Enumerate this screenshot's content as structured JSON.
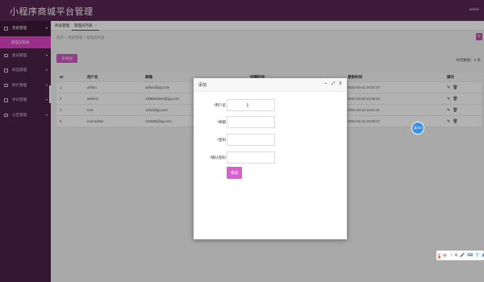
{
  "header": {
    "app_title": "小程序商城平台管理",
    "user": "admin"
  },
  "sidebar": {
    "items": [
      {
        "label": "系统管理",
        "arrow": "▾",
        "sub": [
          {
            "label": "管理员列表"
          }
        ]
      },
      {
        "label": "会员管理",
        "arrow": "▾"
      },
      {
        "label": "商品管理",
        "arrow": "▾"
      },
      {
        "label": "统计管理",
        "arrow": "▾"
      },
      {
        "label": "评论管理",
        "arrow": "▾"
      },
      {
        "label": "公告管理",
        "arrow": "▾"
      }
    ]
  },
  "tabs": [
    {
      "label": "商品管理"
    },
    {
      "label": "管理员列表",
      "close": "×"
    }
  ],
  "breadcrumb": "首页 > 系统管理 > 管理员列表",
  "toolbar": {
    "add_label": "⊕添加",
    "total_label": "共有数据：6 条"
  },
  "table": {
    "headers": [
      "ID",
      "用户名",
      "邮箱",
      "创建时间",
      "更新时间",
      "操作"
    ],
    "rows": [
      [
        "1",
        "admin",
        "admin@qq.com",
        "",
        "2021-04-12 16:27:37"
      ],
      [
        "2",
        "admin1",
        "1455526test@qq.com",
        "",
        "2021-02-02 23:15:43"
      ],
      [
        "4",
        "root",
        "1234@qq.com",
        "",
        "2021-04-12 16:21:21"
      ],
      [
        "5",
        "root-admin",
        "134555@qq.com",
        "",
        "2021-04-12 16:30:37"
      ]
    ],
    "op_edit": "✎",
    "op_delete": "🗑"
  },
  "modal": {
    "title": "添加",
    "minimize": "–",
    "maximize": "⤢",
    "close": "X",
    "fields": [
      {
        "label": "*用户名",
        "value": ""
      },
      {
        "label": "*邮箱",
        "value": ""
      },
      {
        "label": "*密码",
        "value": ""
      },
      {
        "label": "*确认密码",
        "value": ""
      }
    ],
    "submit_label": "增加"
  },
  "float_bubble": {
    "label": "英/EN"
  },
  "tray": {
    "logo": "S",
    "icons": [
      "中",
      "☽",
      "⚙",
      "🎤",
      "⌨",
      "👕",
      "▦"
    ]
  }
}
